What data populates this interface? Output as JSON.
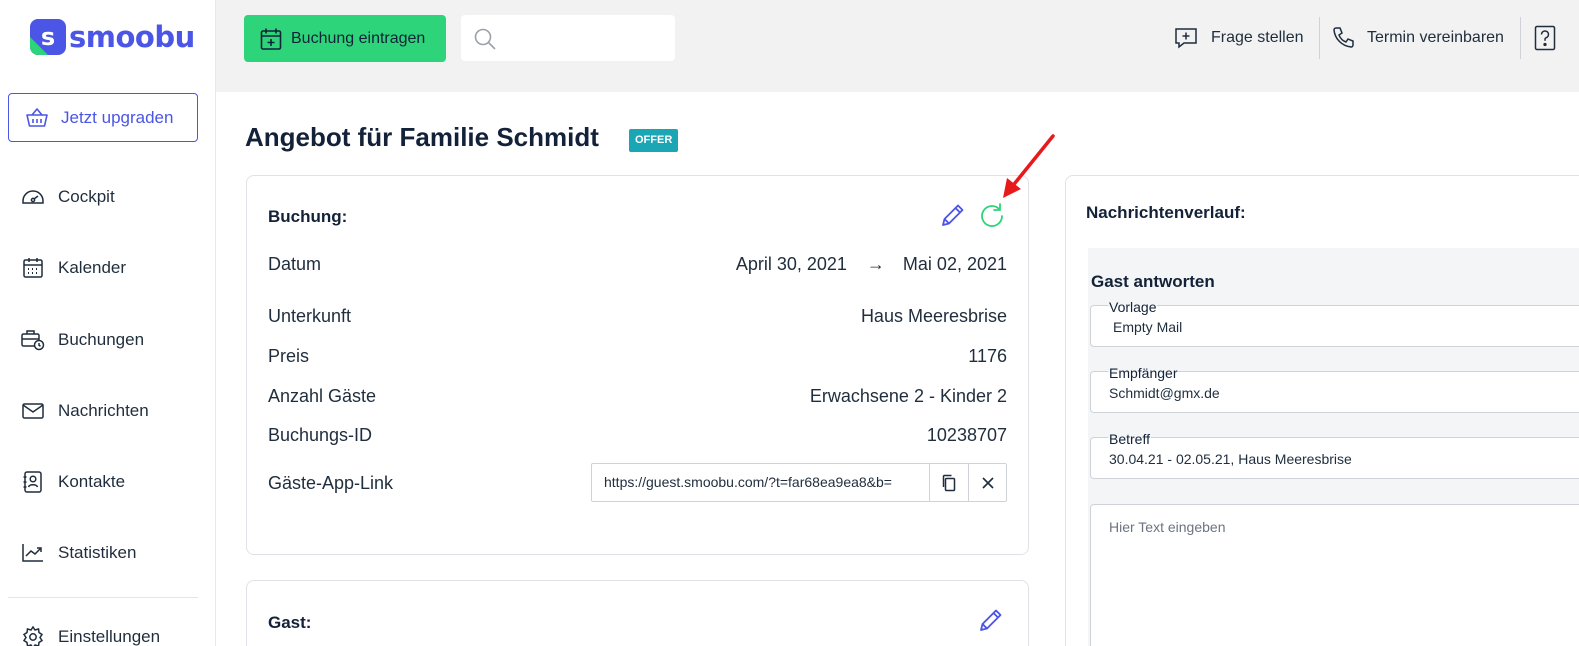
{
  "brand": {
    "name": "smoobu",
    "mark": "s",
    "primary_color": "#4b55e6",
    "accent_color": "#2ed47a"
  },
  "sidebar": {
    "upgrade_label": "Jetzt upgraden",
    "items": [
      {
        "label": "Cockpit",
        "icon": "dashboard-gauge-icon"
      },
      {
        "label": "Kalender",
        "icon": "calendar-icon"
      },
      {
        "label": "Buchungen",
        "icon": "briefcase-clock-icon"
      },
      {
        "label": "Nachrichten",
        "icon": "envelope-icon"
      },
      {
        "label": "Kontakte",
        "icon": "contact-book-icon"
      },
      {
        "label": "Statistiken",
        "icon": "chart-trend-icon"
      },
      {
        "label": "Einstellungen",
        "icon": "gear-icon"
      }
    ]
  },
  "topbar": {
    "add_booking_label": "Buchung eintragen",
    "search_placeholder": "",
    "ask_question_label": "Frage stellen",
    "schedule_label": "Termin vereinbaren",
    "help_icon": "question-mark-icon"
  },
  "page": {
    "title": "Angebot für Familie Schmidt",
    "badge": "OFFER"
  },
  "booking_card": {
    "title": "Buchung:",
    "date_label": "Datum",
    "date_from": "April 30, 2021",
    "date_arrow": "→",
    "date_to": "Mai 02, 2021",
    "rows": [
      {
        "label": "Unterkunft",
        "value": "Haus Meeresbrise"
      },
      {
        "label": "Preis",
        "value": "1176"
      },
      {
        "label": "Anzahl Gäste",
        "value": "Erwachsene 2 - Kinder 2"
      },
      {
        "label": "Buchungs-ID",
        "value": "10238707"
      }
    ],
    "guest_app_label": "Gäste-App-Link",
    "guest_app_link": "https://guest.smoobu.com/?t=far68ea9ea8&b="
  },
  "guest_card": {
    "title": "Gast:"
  },
  "messages": {
    "title": "Nachrichtenverlauf:",
    "reply_title": "Gast antworten",
    "template_label": "Vorlage",
    "template_value": "Empty Mail",
    "recipient_label": "Empfänger",
    "recipient_value": "Schmidt@gmx.de",
    "subject_label": "Betreff",
    "subject_value": "30.04.21 - 02.05.21, Haus Meeresbrise",
    "text_placeholder": "Hier Text eingeben"
  },
  "annotation": {
    "color": "#e8191b"
  }
}
